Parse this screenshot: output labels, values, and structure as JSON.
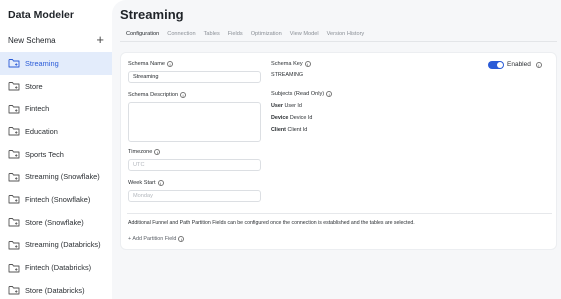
{
  "app": {
    "title": "Data Modeler"
  },
  "sidebar": {
    "new_schema_label": "New Schema",
    "new_schema_icon": "plus-icon",
    "items": [
      {
        "label": "Streaming",
        "icon": "folder-icon",
        "active": true
      },
      {
        "label": "Store",
        "icon": "folder-icon"
      },
      {
        "label": "Fintech",
        "icon": "folder-icon"
      },
      {
        "label": "Education",
        "icon": "folder-icon"
      },
      {
        "label": "Sports Tech",
        "icon": "folder-icon"
      },
      {
        "label": "Streaming (Snowflake)",
        "icon": "folder-icon"
      },
      {
        "label": "Fintech (Snowflake)",
        "icon": "folder-icon"
      },
      {
        "label": "Store (Snowflake)",
        "icon": "folder-icon"
      },
      {
        "label": "Streaming (Databricks)",
        "icon": "folder-icon"
      },
      {
        "label": "Fintech (Databricks)",
        "icon": "folder-icon"
      },
      {
        "label": "Store (Databricks)",
        "icon": "folder-icon"
      }
    ]
  },
  "main": {
    "title": "Streaming",
    "tabs": [
      {
        "label": "Configuration",
        "active": true
      },
      {
        "label": "Connection"
      },
      {
        "label": "Tables"
      },
      {
        "label": "Fields"
      },
      {
        "label": "Optimization"
      },
      {
        "label": "View Model"
      },
      {
        "label": "Version History"
      }
    ]
  },
  "form": {
    "schema_name": {
      "label": "Schema Name",
      "value": "Streaming"
    },
    "schema_description": {
      "label": "Schema Description",
      "value": ""
    },
    "timezone": {
      "label": "Timezone",
      "value": "UTC"
    },
    "week_start": {
      "label": "Week Start",
      "value": "Monday"
    },
    "schema_key": {
      "label": "Schema Key",
      "value": "STREAMING"
    },
    "subjects": {
      "label": "Subjects (Read Only)",
      "items": [
        {
          "name": "User",
          "id": "User Id"
        },
        {
          "name": "Device",
          "id": "Device Id"
        },
        {
          "name": "Client",
          "id": "Client Id"
        }
      ]
    },
    "enabled": {
      "label": "Enabled",
      "on": true
    },
    "partition_note": "Additional Funnel and Path Partition Fields can be configured once the connection is established and the tables are selected.",
    "add_partition_label": "+ Add Partition Field"
  },
  "colors": {
    "accent": "#2a5bd7",
    "active_bg": "#e3ecfb",
    "main_bg": "#f6f7f9"
  }
}
